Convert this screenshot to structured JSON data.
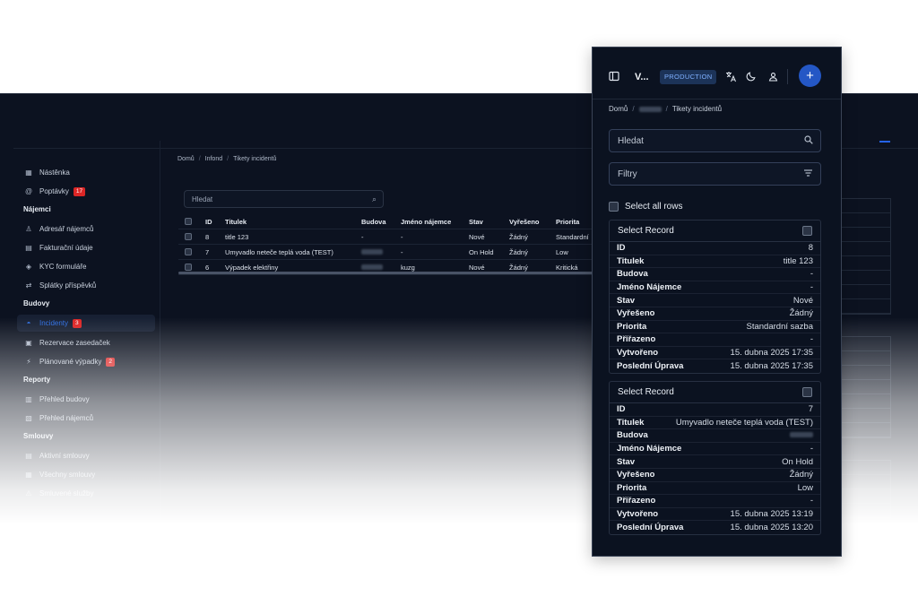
{
  "background": {
    "sidebar": {
      "items": [
        {
          "label": "Nástěnka",
          "icon": "dashboard-icon"
        },
        {
          "label": "Poptávky",
          "icon": "at-icon",
          "badge": "17"
        },
        {
          "group": "Nájemci"
        },
        {
          "label": "Adresář nájemců",
          "icon": "user-icon"
        },
        {
          "label": "Fakturační údaje",
          "icon": "invoice-icon"
        },
        {
          "label": "KYC formuláře",
          "icon": "kyc-icon"
        },
        {
          "label": "Splátky příspěvků",
          "icon": "payment-icon"
        },
        {
          "group": "Budovy"
        },
        {
          "label": "Incidenty",
          "icon": "incident-icon",
          "badge": "3",
          "active": true
        },
        {
          "label": "Rezervace zasedaček",
          "icon": "calendar-icon"
        },
        {
          "label": "Plánované výpadky",
          "icon": "outage-icon",
          "badge": "2"
        },
        {
          "group": "Reporty"
        },
        {
          "label": "Přehled budovy",
          "icon": "building-icon"
        },
        {
          "label": "Přehled nájemců",
          "icon": "report-icon"
        },
        {
          "group": "Smlouvy"
        },
        {
          "label": "Aktivní smlouvy",
          "icon": "contract-icon"
        },
        {
          "label": "Všechny smlouvy",
          "icon": "contracts-icon"
        },
        {
          "label": "Smluvené služby",
          "icon": "service-icon"
        }
      ]
    },
    "breadcrumb": [
      "Domů",
      "Infond",
      "Tikety incidentů"
    ],
    "search_placeholder": "Hledat",
    "table": {
      "headers": [
        "ID",
        "Titulek",
        "Budova",
        "Jméno nájemce",
        "Stav",
        "Vyřešeno",
        "Priorita"
      ],
      "rows": [
        {
          "id": "8",
          "title": "title 123",
          "building": "-",
          "tenant": "-",
          "status": "Nové",
          "resolved": "Žádný",
          "priority": "Standardní"
        },
        {
          "id": "7",
          "title": "Umyvadlo neteče teplá voda (TEST)",
          "building": "",
          "tenant": "-",
          "status": "On Hold",
          "resolved": "Žádný",
          "priority": "Low"
        },
        {
          "id": "6",
          "title": "Výpadek elektřiny",
          "building": "",
          "tenant": "kuzg",
          "status": "Nové",
          "resolved": "Žádný",
          "priority": "Kritická"
        }
      ]
    }
  },
  "panel": {
    "title": "V...",
    "env_badge": "PRODUCTION",
    "icons": [
      "sidebar-toggle-icon",
      "translate-icon",
      "moon-icon",
      "user-icon",
      "plus-icon"
    ],
    "breadcrumb": {
      "home": "Domů",
      "current": "Tikety incidentů"
    },
    "search_placeholder": "Hledat",
    "filters_label": "Filtry",
    "select_all_label": "Select all rows",
    "records": [
      {
        "select_label": "Select Record",
        "fields": [
          {
            "key": "ID",
            "value": "8"
          },
          {
            "key": "Titulek",
            "value": "title 123"
          },
          {
            "key": "Budova",
            "value": "-"
          },
          {
            "key": "Jméno Nájemce",
            "value": "-"
          },
          {
            "key": "Stav",
            "value": "Nové"
          },
          {
            "key": "Vyřešeno",
            "value": "Žádný"
          },
          {
            "key": "Priorita",
            "value": "Standardní sazba"
          },
          {
            "key": "Přiřazeno",
            "value": "-"
          },
          {
            "key": "Vytvořeno",
            "value": "15. dubna 2025 17:35"
          },
          {
            "key": "Poslední Úprava",
            "value": "15. dubna 2025 17:35"
          }
        ]
      },
      {
        "select_label": "Select Record",
        "fields": [
          {
            "key": "ID",
            "value": "7"
          },
          {
            "key": "Titulek",
            "value": "Umyvadlo neteče teplá voda (TEST)"
          },
          {
            "key": "Budova",
            "value": ""
          },
          {
            "key": "Jméno Nájemce",
            "value": "-"
          },
          {
            "key": "Stav",
            "value": "On Hold"
          },
          {
            "key": "Vyřešeno",
            "value": "Žádný"
          },
          {
            "key": "Priorita",
            "value": "Low"
          },
          {
            "key": "Přiřazeno",
            "value": "-"
          },
          {
            "key": "Vytvořeno",
            "value": "15. dubna 2025 13:19"
          },
          {
            "key": "Poslední Úprava",
            "value": "15. dubna 2025 13:20"
          }
        ]
      }
    ]
  }
}
